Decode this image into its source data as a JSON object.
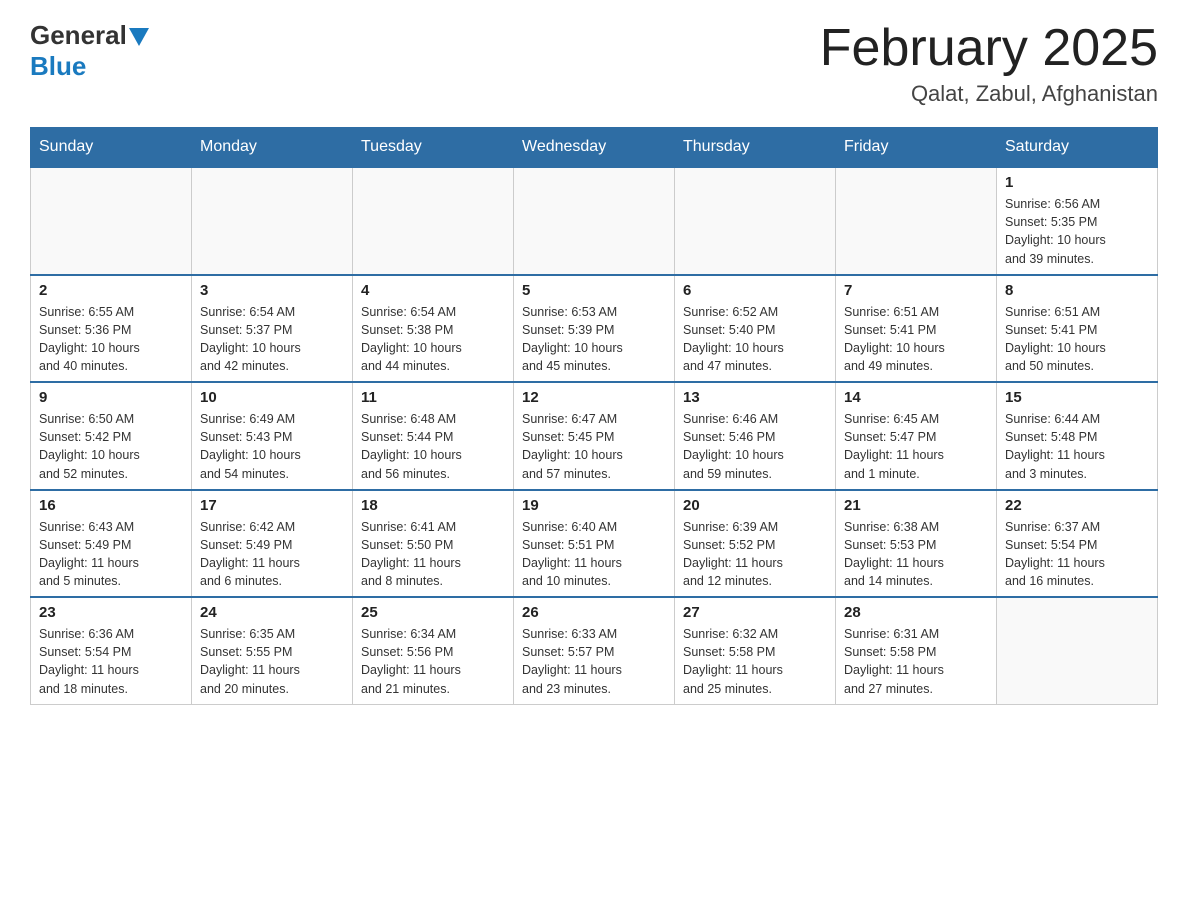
{
  "logo": {
    "general": "General",
    "blue": "Blue"
  },
  "title": "February 2025",
  "location": "Qalat, Zabul, Afghanistan",
  "days_header": [
    "Sunday",
    "Monday",
    "Tuesday",
    "Wednesday",
    "Thursday",
    "Friday",
    "Saturday"
  ],
  "weeks": [
    [
      {
        "day": "",
        "info": ""
      },
      {
        "day": "",
        "info": ""
      },
      {
        "day": "",
        "info": ""
      },
      {
        "day": "",
        "info": ""
      },
      {
        "day": "",
        "info": ""
      },
      {
        "day": "",
        "info": ""
      },
      {
        "day": "1",
        "info": "Sunrise: 6:56 AM\nSunset: 5:35 PM\nDaylight: 10 hours\nand 39 minutes."
      }
    ],
    [
      {
        "day": "2",
        "info": "Sunrise: 6:55 AM\nSunset: 5:36 PM\nDaylight: 10 hours\nand 40 minutes."
      },
      {
        "day": "3",
        "info": "Sunrise: 6:54 AM\nSunset: 5:37 PM\nDaylight: 10 hours\nand 42 minutes."
      },
      {
        "day": "4",
        "info": "Sunrise: 6:54 AM\nSunset: 5:38 PM\nDaylight: 10 hours\nand 44 minutes."
      },
      {
        "day": "5",
        "info": "Sunrise: 6:53 AM\nSunset: 5:39 PM\nDaylight: 10 hours\nand 45 minutes."
      },
      {
        "day": "6",
        "info": "Sunrise: 6:52 AM\nSunset: 5:40 PM\nDaylight: 10 hours\nand 47 minutes."
      },
      {
        "day": "7",
        "info": "Sunrise: 6:51 AM\nSunset: 5:41 PM\nDaylight: 10 hours\nand 49 minutes."
      },
      {
        "day": "8",
        "info": "Sunrise: 6:51 AM\nSunset: 5:41 PM\nDaylight: 10 hours\nand 50 minutes."
      }
    ],
    [
      {
        "day": "9",
        "info": "Sunrise: 6:50 AM\nSunset: 5:42 PM\nDaylight: 10 hours\nand 52 minutes."
      },
      {
        "day": "10",
        "info": "Sunrise: 6:49 AM\nSunset: 5:43 PM\nDaylight: 10 hours\nand 54 minutes."
      },
      {
        "day": "11",
        "info": "Sunrise: 6:48 AM\nSunset: 5:44 PM\nDaylight: 10 hours\nand 56 minutes."
      },
      {
        "day": "12",
        "info": "Sunrise: 6:47 AM\nSunset: 5:45 PM\nDaylight: 10 hours\nand 57 minutes."
      },
      {
        "day": "13",
        "info": "Sunrise: 6:46 AM\nSunset: 5:46 PM\nDaylight: 10 hours\nand 59 minutes."
      },
      {
        "day": "14",
        "info": "Sunrise: 6:45 AM\nSunset: 5:47 PM\nDaylight: 11 hours\nand 1 minute."
      },
      {
        "day": "15",
        "info": "Sunrise: 6:44 AM\nSunset: 5:48 PM\nDaylight: 11 hours\nand 3 minutes."
      }
    ],
    [
      {
        "day": "16",
        "info": "Sunrise: 6:43 AM\nSunset: 5:49 PM\nDaylight: 11 hours\nand 5 minutes."
      },
      {
        "day": "17",
        "info": "Sunrise: 6:42 AM\nSunset: 5:49 PM\nDaylight: 11 hours\nand 6 minutes."
      },
      {
        "day": "18",
        "info": "Sunrise: 6:41 AM\nSunset: 5:50 PM\nDaylight: 11 hours\nand 8 minutes."
      },
      {
        "day": "19",
        "info": "Sunrise: 6:40 AM\nSunset: 5:51 PM\nDaylight: 11 hours\nand 10 minutes."
      },
      {
        "day": "20",
        "info": "Sunrise: 6:39 AM\nSunset: 5:52 PM\nDaylight: 11 hours\nand 12 minutes."
      },
      {
        "day": "21",
        "info": "Sunrise: 6:38 AM\nSunset: 5:53 PM\nDaylight: 11 hours\nand 14 minutes."
      },
      {
        "day": "22",
        "info": "Sunrise: 6:37 AM\nSunset: 5:54 PM\nDaylight: 11 hours\nand 16 minutes."
      }
    ],
    [
      {
        "day": "23",
        "info": "Sunrise: 6:36 AM\nSunset: 5:54 PM\nDaylight: 11 hours\nand 18 minutes."
      },
      {
        "day": "24",
        "info": "Sunrise: 6:35 AM\nSunset: 5:55 PM\nDaylight: 11 hours\nand 20 minutes."
      },
      {
        "day": "25",
        "info": "Sunrise: 6:34 AM\nSunset: 5:56 PM\nDaylight: 11 hours\nand 21 minutes."
      },
      {
        "day": "26",
        "info": "Sunrise: 6:33 AM\nSunset: 5:57 PM\nDaylight: 11 hours\nand 23 minutes."
      },
      {
        "day": "27",
        "info": "Sunrise: 6:32 AM\nSunset: 5:58 PM\nDaylight: 11 hours\nand 25 minutes."
      },
      {
        "day": "28",
        "info": "Sunrise: 6:31 AM\nSunset: 5:58 PM\nDaylight: 11 hours\nand 27 minutes."
      },
      {
        "day": "",
        "info": ""
      }
    ]
  ]
}
